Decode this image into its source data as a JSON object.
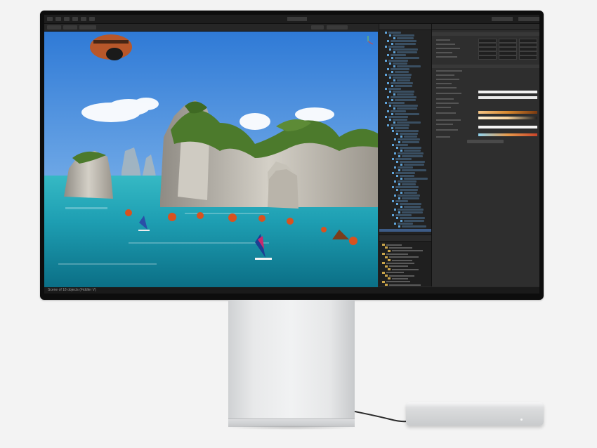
{
  "scene": {
    "statusbar_text": "Scene of 18 objects (Fiddler V)",
    "colors": {
      "sky_top": "#2f7ad6",
      "sky_bottom": "#9cc9f2",
      "water_top": "#1e9fb3",
      "water_bottom": "#0b6f86",
      "rock": "#bfbab0",
      "foliage": "#4c7a2c",
      "buoy": "#d8521f"
    }
  },
  "editor": {
    "accent": "#3d5b86",
    "panel_bg": "#2e2e2e"
  },
  "hardware": {
    "monitor_bezel": "#0d0d0d",
    "aluminum": "#e3e4e5"
  }
}
